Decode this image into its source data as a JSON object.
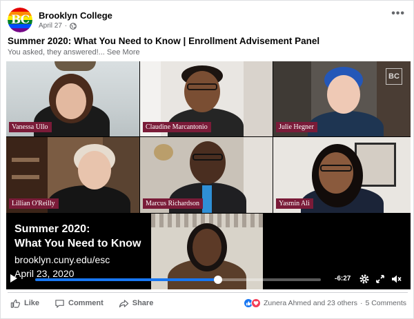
{
  "page": {
    "name": "Brooklyn College",
    "date": "April 27",
    "avatar_letters": "BC"
  },
  "post": {
    "title": "Summer 2020: What You Need to Know | Enrollment Advisement Panel",
    "subtitle": "You asked, they answered!...",
    "see_more": "See More"
  },
  "video": {
    "participants": [
      {
        "name": "Vanessa Ullo"
      },
      {
        "name": "Claudine Marcantonio"
      },
      {
        "name": "Julie Hegner"
      },
      {
        "name": "Lillian O'Reilly"
      },
      {
        "name": "Marcus Richardson"
      },
      {
        "name": "Yasmin Ali"
      }
    ],
    "overlay": {
      "line1": "Summer 2020:",
      "line2": "What You Need to Know",
      "line3": "brooklyn.cuny.edu/esc",
      "line4": "April 23, 2020"
    },
    "logo_text": "BC",
    "time_remaining": "-6:27",
    "progress": 0.64
  },
  "actions": {
    "like": "Like",
    "comment": "Comment",
    "share": "Share"
  },
  "reactions": {
    "summary": "Zunera Ahmed and 23 others",
    "comments": "5 Comments"
  },
  "colors": {
    "accent": "#1877f2",
    "nametag": "#7a1b38",
    "love": "#f33e58"
  },
  "icons": [
    "globe-icon",
    "more-icon",
    "play-icon",
    "settings-icon",
    "fullscreen-icon",
    "volume-icon",
    "like-icon",
    "comment-icon",
    "share-icon"
  ]
}
